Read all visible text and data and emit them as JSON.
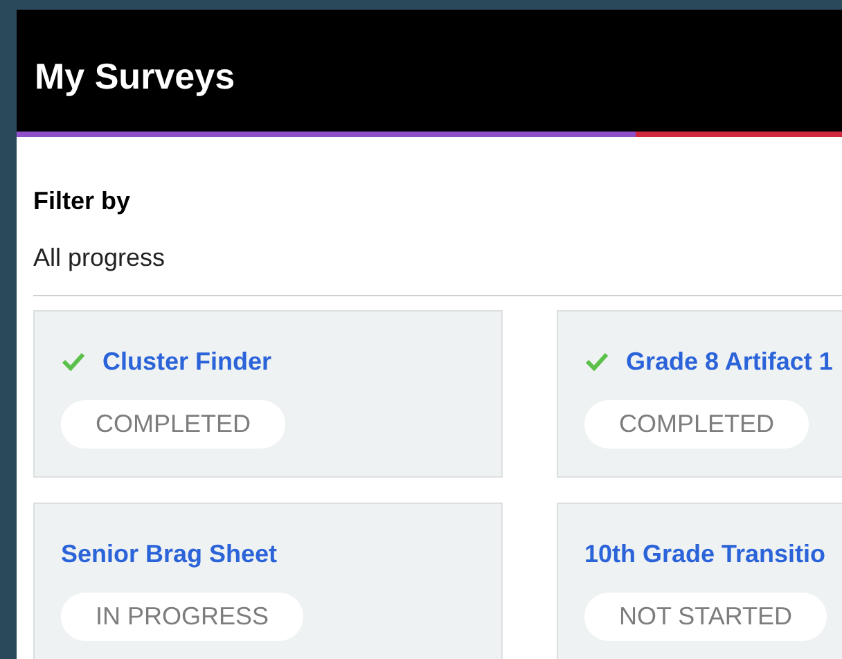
{
  "header": {
    "title": "My Surveys"
  },
  "filter": {
    "label": "Filter by",
    "value": "All progress"
  },
  "surveys": [
    {
      "title": "Cluster Finder",
      "completed": true,
      "status": "COMPLETED"
    },
    {
      "title": "Grade 8 Artifact 1",
      "completed": true,
      "status": "COMPLETED"
    },
    {
      "title": "Senior Brag Sheet",
      "completed": false,
      "status": "IN PROGRESS"
    },
    {
      "title": "10th Grade Transitio",
      "completed": false,
      "status": "NOT STARTED"
    }
  ]
}
